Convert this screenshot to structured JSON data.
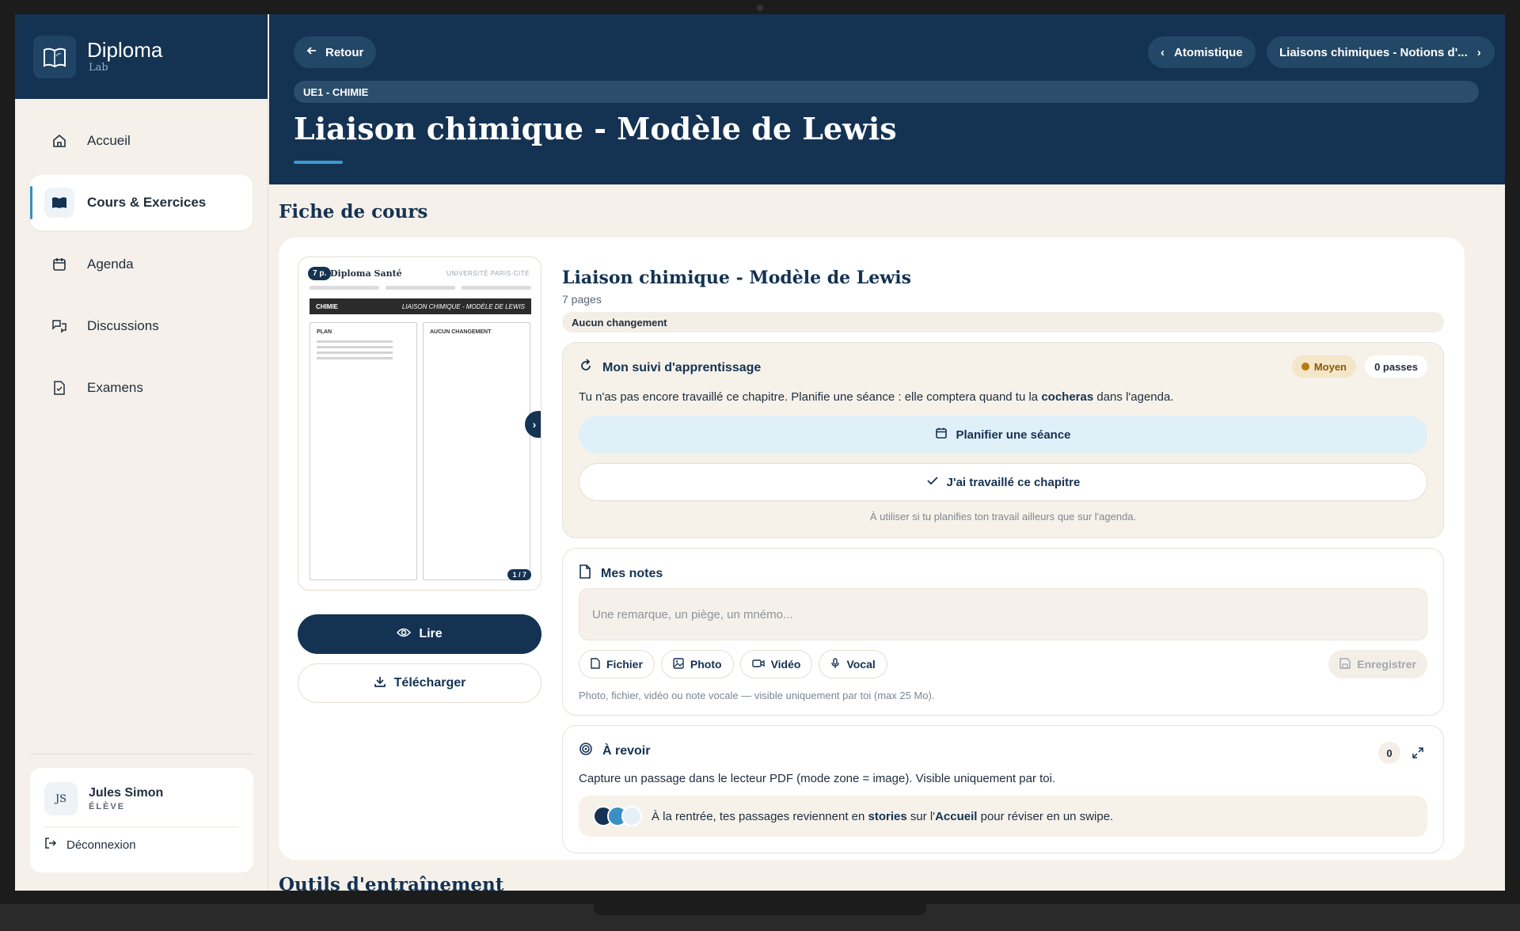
{
  "brand": {
    "name": "Diploma",
    "sub": "Lab"
  },
  "sidebar": {
    "items": [
      {
        "label": "Accueil",
        "icon": "home-icon"
      },
      {
        "label": "Cours & Exercices",
        "icon": "book-icon",
        "active": true
      },
      {
        "label": "Agenda",
        "icon": "calendar-icon"
      },
      {
        "label": "Discussions",
        "icon": "chat-icon"
      },
      {
        "label": "Examens",
        "icon": "exam-icon"
      }
    ]
  },
  "user": {
    "initials": "JS",
    "name": "Jules Simon",
    "role": "ÉLÈVE",
    "logout": "Déconnexion"
  },
  "header": {
    "back": "Retour",
    "prev": "Atomistique",
    "next": "Liaisons chimiques - Notions d'...",
    "ue": "UE1 - CHIMIE",
    "title": "Liaison chimique - Modèle de Lewis"
  },
  "section": {
    "fiche": "Fiche de cours",
    "outils": "Outils d'entraînement"
  },
  "preview": {
    "badge": "7 p.",
    "brand": "Diploma Santé",
    "univ": "UNIVERSITÉ PARIS-CITÉ",
    "head_left": "CHIMIE",
    "head_right": "LIAISON CHIMIQUE - MODÈLE DE LEWIS",
    "col1": "PLAN",
    "col2": "AUCUN CHANGEMENT",
    "page": "1 / 7"
  },
  "actions": {
    "read": "Lire",
    "download": "Télécharger"
  },
  "course": {
    "title": "Liaison chimique - Modèle de Lewis",
    "pages": "7 pages",
    "change": "Aucun changement"
  },
  "suivi": {
    "title": "Mon suivi d'apprentissage",
    "level": "Moyen",
    "passes": "0 passes",
    "text_before": "Tu n'as pas encore travaillé ce chapitre. Planifie une séance : elle comptera quand tu la ",
    "text_bold": "cocheras",
    "text_after": " dans l'agenda.",
    "plan_btn": "Planifier une séance",
    "done_btn": "J'ai travaillé ce chapitre",
    "hint": "À utiliser si tu planifies ton travail ailleurs que sur l'agenda."
  },
  "notes": {
    "title": "Mes notes",
    "placeholder": "Une remarque, un piège, un mnémo...",
    "tools": [
      "Fichier",
      "Photo",
      "Vidéo",
      "Vocal"
    ],
    "save": "Enregistrer",
    "hint": "Photo, fichier, vidéo ou note vocale — visible uniquement par toi (max 25 Mo)."
  },
  "revoir": {
    "title": "À revoir",
    "count": "0",
    "text": "Capture un passage dans le lecteur PDF (mode zone = image). Visible uniquement par toi.",
    "box_a": "À la rentrée, tes passages reviennent en ",
    "box_b": "stories",
    "box_c": " sur l'",
    "box_d": "Accueil",
    "box_e": " pour réviser en un swipe."
  },
  "colors": {
    "navy": "#143252",
    "accent": "#3a9ad2",
    "moyen": "#b77a12"
  }
}
